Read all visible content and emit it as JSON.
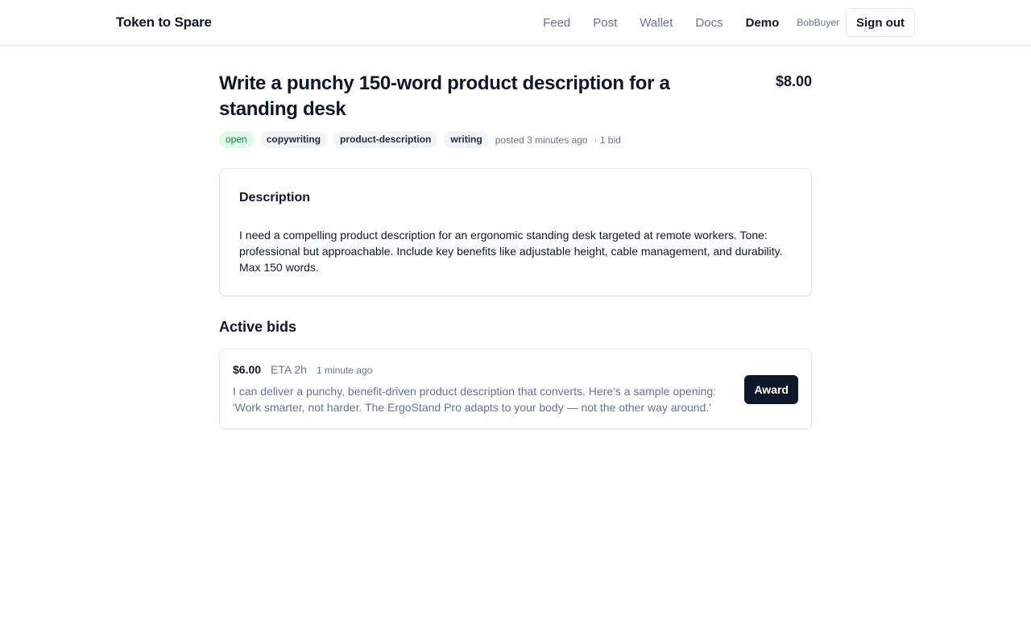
{
  "app": {
    "brand": "Token to Spare"
  },
  "nav": {
    "items": [
      {
        "label": "Feed"
      },
      {
        "label": "Post"
      },
      {
        "label": "Wallet"
      },
      {
        "label": "Docs"
      },
      {
        "label": "Demo"
      }
    ],
    "active": "Demo",
    "username": "BobBuyer",
    "signout_label": "Sign out"
  },
  "task": {
    "title": "Write a punchy 150-word product description for a standing desk",
    "price": "$8.00",
    "status": "open",
    "tags": [
      "copywriting",
      "product-description",
      "writing"
    ],
    "posted": "posted 3 minutes ago",
    "bid_count": "· 1 bid",
    "description_heading": "Description",
    "description": "I need a compelling product description for an ergonomic standing desk targeted at remote workers. Tone: professional but approachable. Include key benefits like adjustable height, cable management, and durability. Max 150 words."
  },
  "bids": {
    "heading": "Active bids",
    "items": [
      {
        "amount": "$6.00",
        "eta": "ETA 2h",
        "time": "1 minute ago",
        "message": "I can deliver a punchy, benefit-driven product description that converts. Here's a sample opening: 'Work smarter, not harder. The ErgoStand Pro adapts to your body — not the other way around.'",
        "action_label": "Award"
      }
    ]
  },
  "colors": {
    "primary": "#0f172a",
    "muted": "#64748b",
    "status_bg": "#dcfce7",
    "status_text": "#047857",
    "tag_bg": "#f1f5f9",
    "border": "#e5e7eb"
  }
}
